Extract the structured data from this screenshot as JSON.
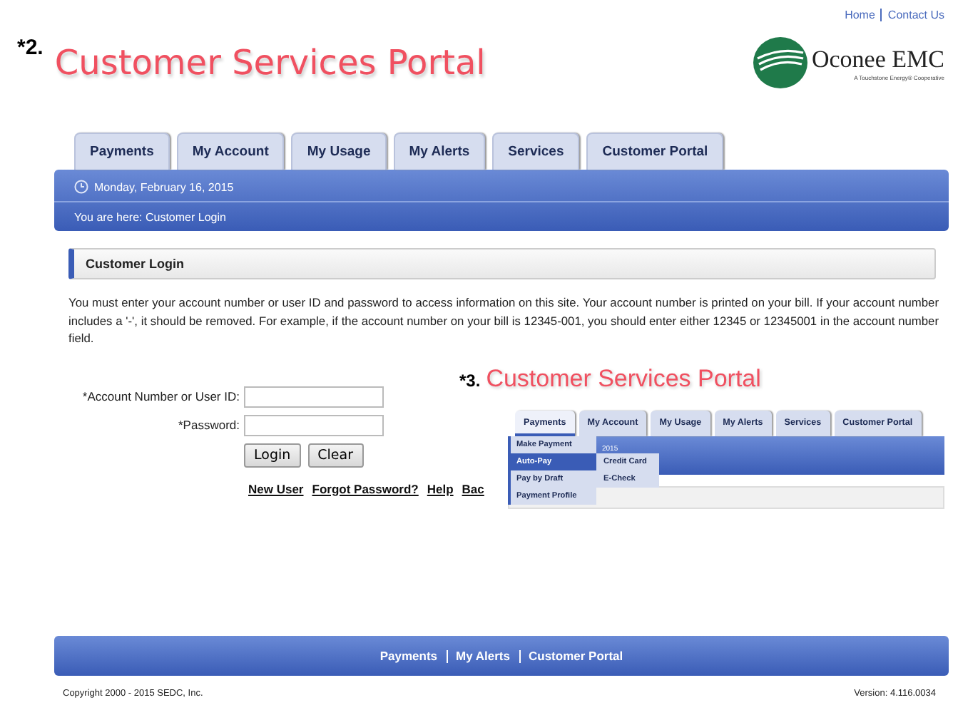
{
  "top_links": [
    "Home",
    "Contact Us"
  ],
  "header": {
    "step": "*2.",
    "title": "Customer Services Portal",
    "logo": {
      "name": "Oconee EMC",
      "tagline": "A Touchstone Energy® Cooperative"
    }
  },
  "tabs": [
    {
      "label": "Payments",
      "selected": false
    },
    {
      "label": "My Account",
      "selected": false
    },
    {
      "label": "My Usage",
      "selected": false
    },
    {
      "label": "My Alerts",
      "selected": false
    },
    {
      "label": "Services",
      "selected": false
    },
    {
      "label": "Customer Portal",
      "selected": false
    }
  ],
  "date_bar": {
    "date": "Monday, February 16, 2015",
    "breadcrumb": "You are here:  Customer Login"
  },
  "section_title": "Customer Login",
  "intro": "You must enter your account number or user ID and password to access information on this site. Your account number is printed on your bill. If your account number includes a '-', it should be removed. For example, if the account number on your bill is 12345-001, you should enter either 12345 or 12345001 in the account number field.",
  "form": {
    "fields": [
      {
        "label": "*Account Number or User ID:"
      },
      {
        "label": "*Password:"
      }
    ],
    "buttons": [
      "Login",
      "Clear"
    ],
    "links": [
      "New User",
      "Forgot Password?",
      "Help",
      "Bac"
    ]
  },
  "inset": {
    "step": "*3.",
    "title": "Customer Services Portal",
    "tabs": [
      {
        "label": "Payments",
        "selected": true
      },
      {
        "label": "My Account",
        "selected": false
      },
      {
        "label": "My Usage",
        "selected": false
      },
      {
        "label": "My Alerts",
        "selected": false
      },
      {
        "label": "Services",
        "selected": false
      },
      {
        "label": "Customer Portal",
        "selected": false
      }
    ],
    "bar_text": "2015",
    "menu": [
      {
        "label": "Make Payment",
        "selected": false
      },
      {
        "label": "Auto-Pay",
        "selected": true
      },
      {
        "label": "Pay by Draft",
        "selected": false
      },
      {
        "label": "Payment Profile",
        "selected": false
      }
    ],
    "submenu": [
      "Credit Card",
      "E-Check"
    ]
  },
  "footer_links": [
    "Payments",
    "My Alerts",
    "Customer Portal"
  ],
  "copyright": "Copyright 2000 - 2015 SEDC, Inc.",
  "version": "Version: 4.116.0034"
}
